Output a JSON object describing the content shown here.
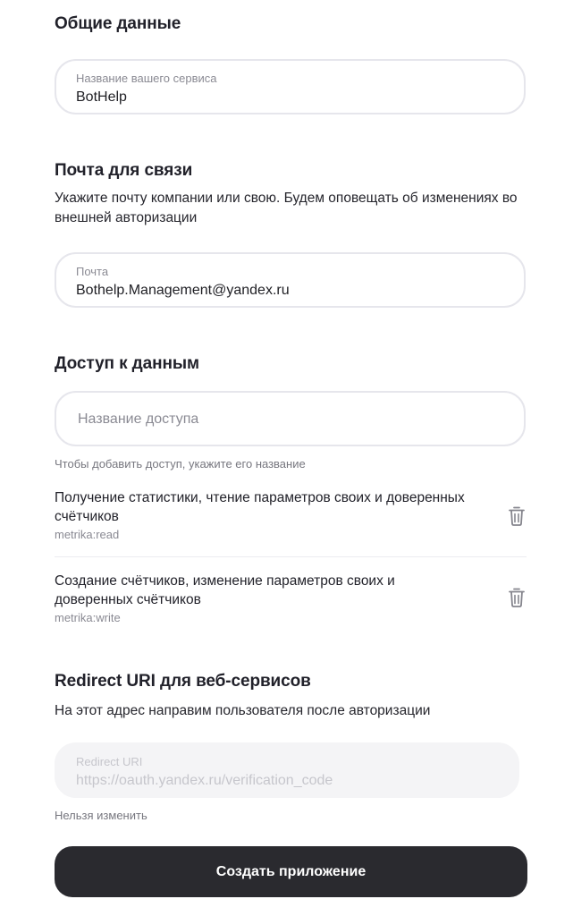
{
  "general": {
    "title": "Общие данные",
    "service_name_label": "Название вашего сервиса",
    "service_name_value": "BotHelp"
  },
  "contact": {
    "title": "Почта для связи",
    "description": "Укажите почту компании или свою. Будем оповещать об изменениях во внешней авторизации",
    "email_label": "Почта",
    "email_value": "Bothelp.Management@yandex.ru"
  },
  "access": {
    "title": "Доступ к данным",
    "input_placeholder": "Название доступа",
    "hint": "Чтобы добавить доступ, укажите его название",
    "scopes": [
      {
        "name": "Получение статистики, чтение параметров своих и доверенных счётчиков",
        "id": "metrika:read",
        "delete_icon": "trash-icon"
      },
      {
        "name": "Создание счётчиков, изменение параметров своих и доверенных счётчиков",
        "id": "metrika:write",
        "delete_icon": "trash-icon"
      }
    ]
  },
  "redirect": {
    "title": "Redirect URI для веб-сервисов",
    "description": "На этот адрес направим пользователя после авторизации",
    "field_label": "Redirect URI",
    "field_value": "https://oauth.yandex.ru/verification_code",
    "note": "Нельзя изменить"
  },
  "submit": {
    "label": "Создать приложение"
  },
  "colors": {
    "button_bg": "#2a2a2f",
    "border": "#e6e6ec",
    "disabled_bg": "#f4f4f6",
    "muted_text": "#8a8a93"
  }
}
